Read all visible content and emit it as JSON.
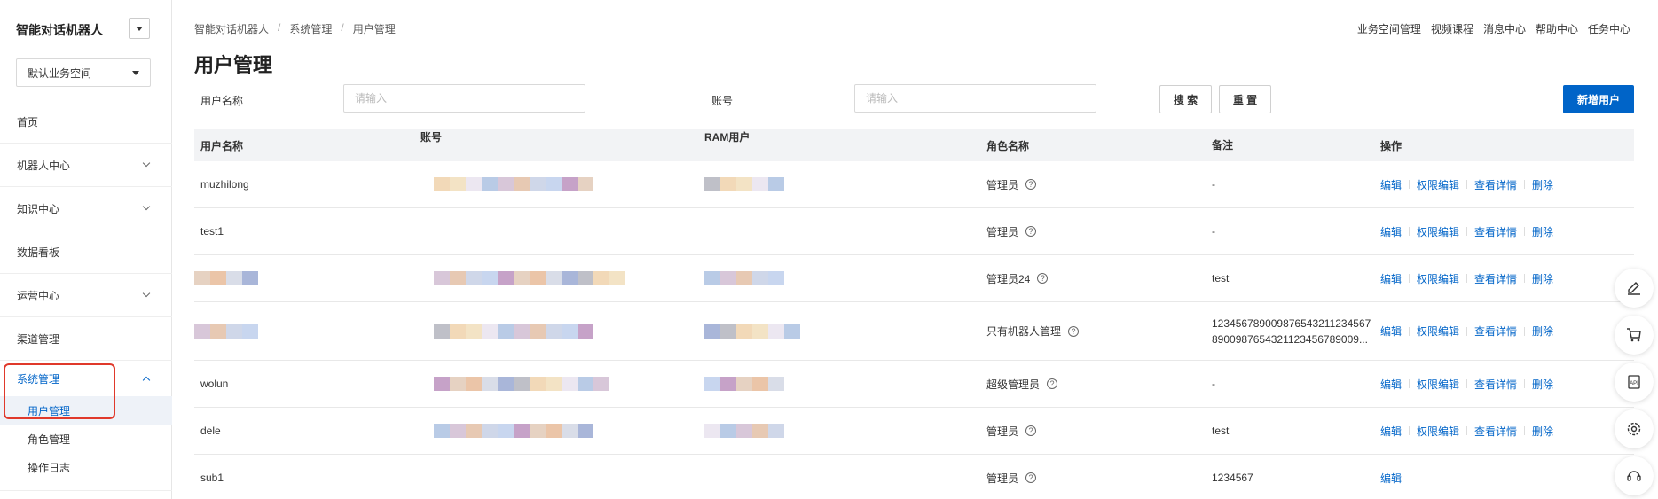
{
  "sidebar": {
    "app_title": "智能对话机器人",
    "workspace": "默认业务空间",
    "items": [
      {
        "label": "首页"
      },
      {
        "label": "机器人中心"
      },
      {
        "label": "知识中心"
      },
      {
        "label": "数据看板"
      },
      {
        "label": "运营中心"
      },
      {
        "label": "渠道管理"
      },
      {
        "label": "系统管理"
      }
    ],
    "sub_items": [
      {
        "label": "用户管理"
      },
      {
        "label": "角色管理"
      },
      {
        "label": "操作日志"
      }
    ]
  },
  "breadcrumb": [
    "智能对话机器人",
    "系统管理",
    "用户管理"
  ],
  "top_links": [
    "业务空间管理",
    "视频课程",
    "消息中心",
    "帮助中心",
    "任务中心"
  ],
  "page_title": "用户管理",
  "filters": {
    "username_label": "用户名称",
    "username_placeholder": "请输入",
    "account_label": "账号",
    "account_placeholder": "请输入",
    "search_button": "搜 索",
    "reset_button": "重 置",
    "add_user_button": "新增用户"
  },
  "table": {
    "headers": [
      "用户名称",
      "账号",
      "RAM用户",
      "角色名称",
      "备注",
      "操作"
    ],
    "rows": [
      {
        "name": "muzhilong",
        "role": "管理员",
        "remark": "-",
        "remark2": ""
      },
      {
        "name": "test1",
        "role": "管理员",
        "remark": "-",
        "remark2": ""
      },
      {
        "name": "",
        "role": "管理员24",
        "remark": "test",
        "remark2": ""
      },
      {
        "name": "",
        "role": "只有机器人管理",
        "remark": "12345678900987654321123456​7",
        "remark2": "89009876543211234567890​09..."
      },
      {
        "name": "wolun",
        "role": "超级管理员",
        "remark": "-",
        "remark2": ""
      },
      {
        "name": "dele",
        "role": "管理员",
        "remark": "test",
        "remark2": ""
      },
      {
        "name": "sub1",
        "role": "管理员",
        "remark": "1234567",
        "remark2": ""
      }
    ],
    "ops": {
      "edit": "编辑",
      "perm_edit": "权限编辑",
      "view": "查看详情",
      "delete": "删除"
    }
  },
  "colors": {
    "accent": "#0064c8",
    "highlight": "#e0392b"
  },
  "float_tools": [
    "edit-icon",
    "cart-icon",
    "api-icon",
    "settings-icon",
    "support-icon"
  ]
}
